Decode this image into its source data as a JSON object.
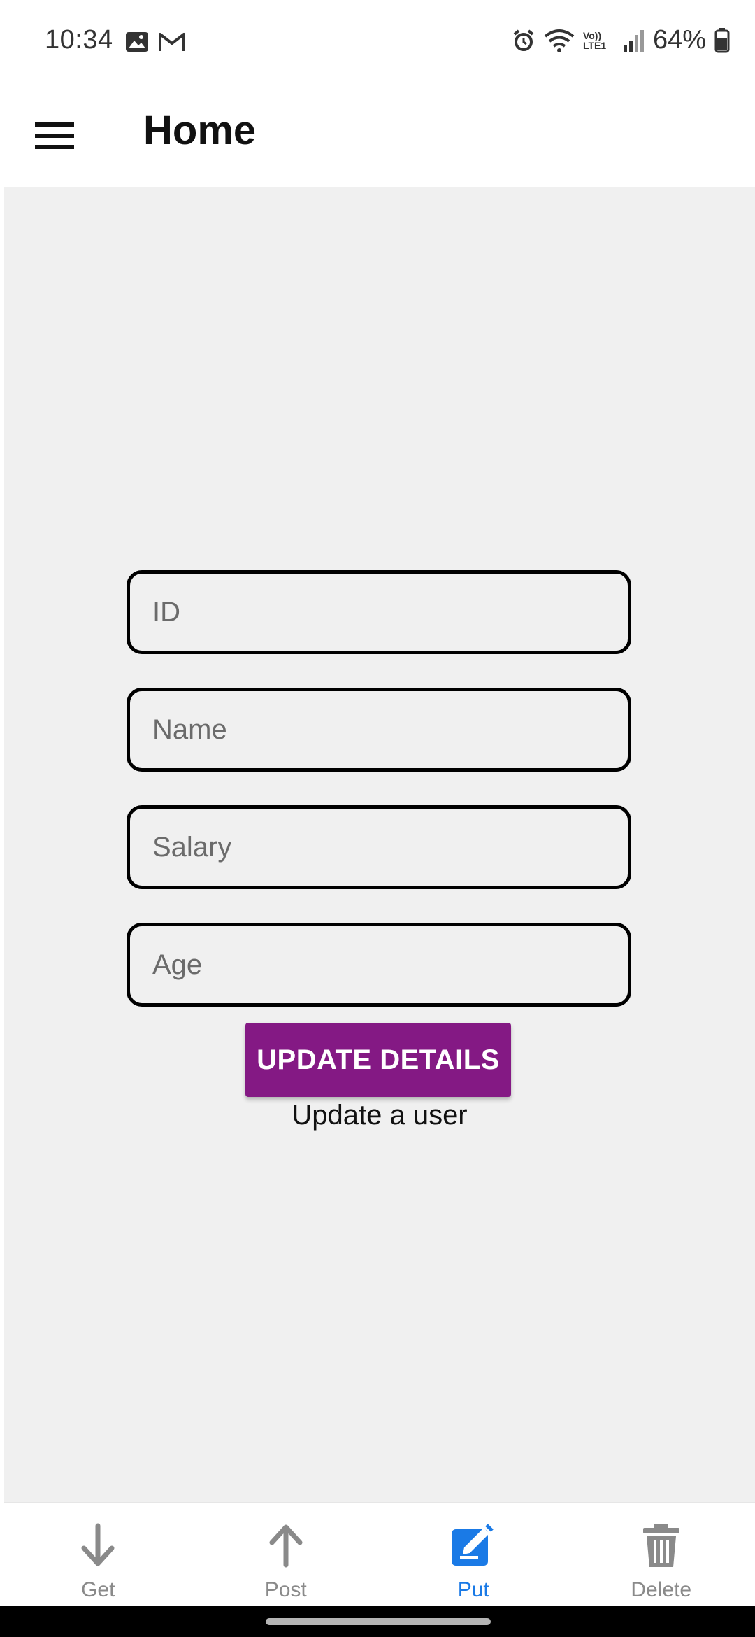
{
  "status_bar": {
    "time": "10:34",
    "battery": "64%",
    "network_label": "Vo)) LTE1"
  },
  "app_bar": {
    "title": "Home",
    "menu_icon": "hamburger-menu-icon"
  },
  "form": {
    "fields": [
      {
        "placeholder": "ID",
        "value": ""
      },
      {
        "placeholder": "Name",
        "value": ""
      },
      {
        "placeholder": "Salary",
        "value": ""
      },
      {
        "placeholder": "Age",
        "value": ""
      }
    ],
    "button_label": "UPDATE DETAILS",
    "caption": "Update a user"
  },
  "bottom_nav": {
    "items": [
      {
        "label": "Get",
        "icon": "arrow-down-icon",
        "active": false
      },
      {
        "label": "Post",
        "icon": "arrow-up-icon",
        "active": false
      },
      {
        "label": "Put",
        "icon": "edit-icon",
        "active": true
      },
      {
        "label": "Delete",
        "icon": "trash-icon",
        "active": false
      }
    ]
  },
  "colors": {
    "accent_button": "#841984",
    "active_tab": "#1a7ae6",
    "inactive_tab": "#8a8a8a",
    "content_background": "#f0f0f0"
  }
}
